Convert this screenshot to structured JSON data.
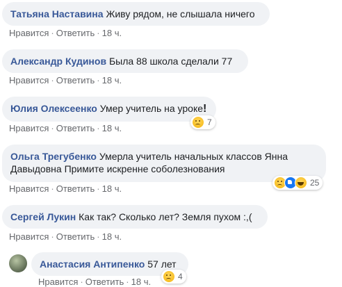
{
  "comments": [
    {
      "author": "Татьяна Наставина",
      "text": "Живу рядом, не слышала ничего",
      "like": "Нравится",
      "reply": "Ответить",
      "time": "18 ч.",
      "reactions": null
    },
    {
      "author": "Александр Кудинов",
      "text": "Была 88 школа сделали 77",
      "like": "Нравится",
      "reply": "Ответить",
      "time": "18 ч.",
      "reactions": null
    },
    {
      "author": "Юлия Олексеенко",
      "text": "Умер учитель на уроке",
      "text_suffix": "!",
      "like": "Нравится",
      "reply": "Ответить",
      "time": "18 ч.",
      "reactions": {
        "icons": [
          "sad"
        ],
        "count": "7"
      }
    },
    {
      "author": "Ольга Трегубенко",
      "text_line1": "Умерла учитель начальных классов Янна",
      "text_line2": "Давыдовна Примите искренне соболезнования",
      "like": "Нравится",
      "reply": "Ответить",
      "time": "18 ч.",
      "reactions": {
        "icons": [
          "sad",
          "like",
          "haha"
        ],
        "count": "25"
      }
    },
    {
      "author": "Сергей Лукин",
      "text": "Как так? Сколько лет? Земля пухом :,(",
      "like": "Нравится",
      "reply": "Ответить",
      "time": "18 ч.",
      "reactions": null
    },
    {
      "author": "Анастасия Антипенко",
      "text": "57 лет",
      "like": "Нравится",
      "reply": "Ответить",
      "time": "18 ч.",
      "reactions": {
        "icons": [
          "sad"
        ],
        "count": "4"
      }
    }
  ],
  "separator": "·"
}
